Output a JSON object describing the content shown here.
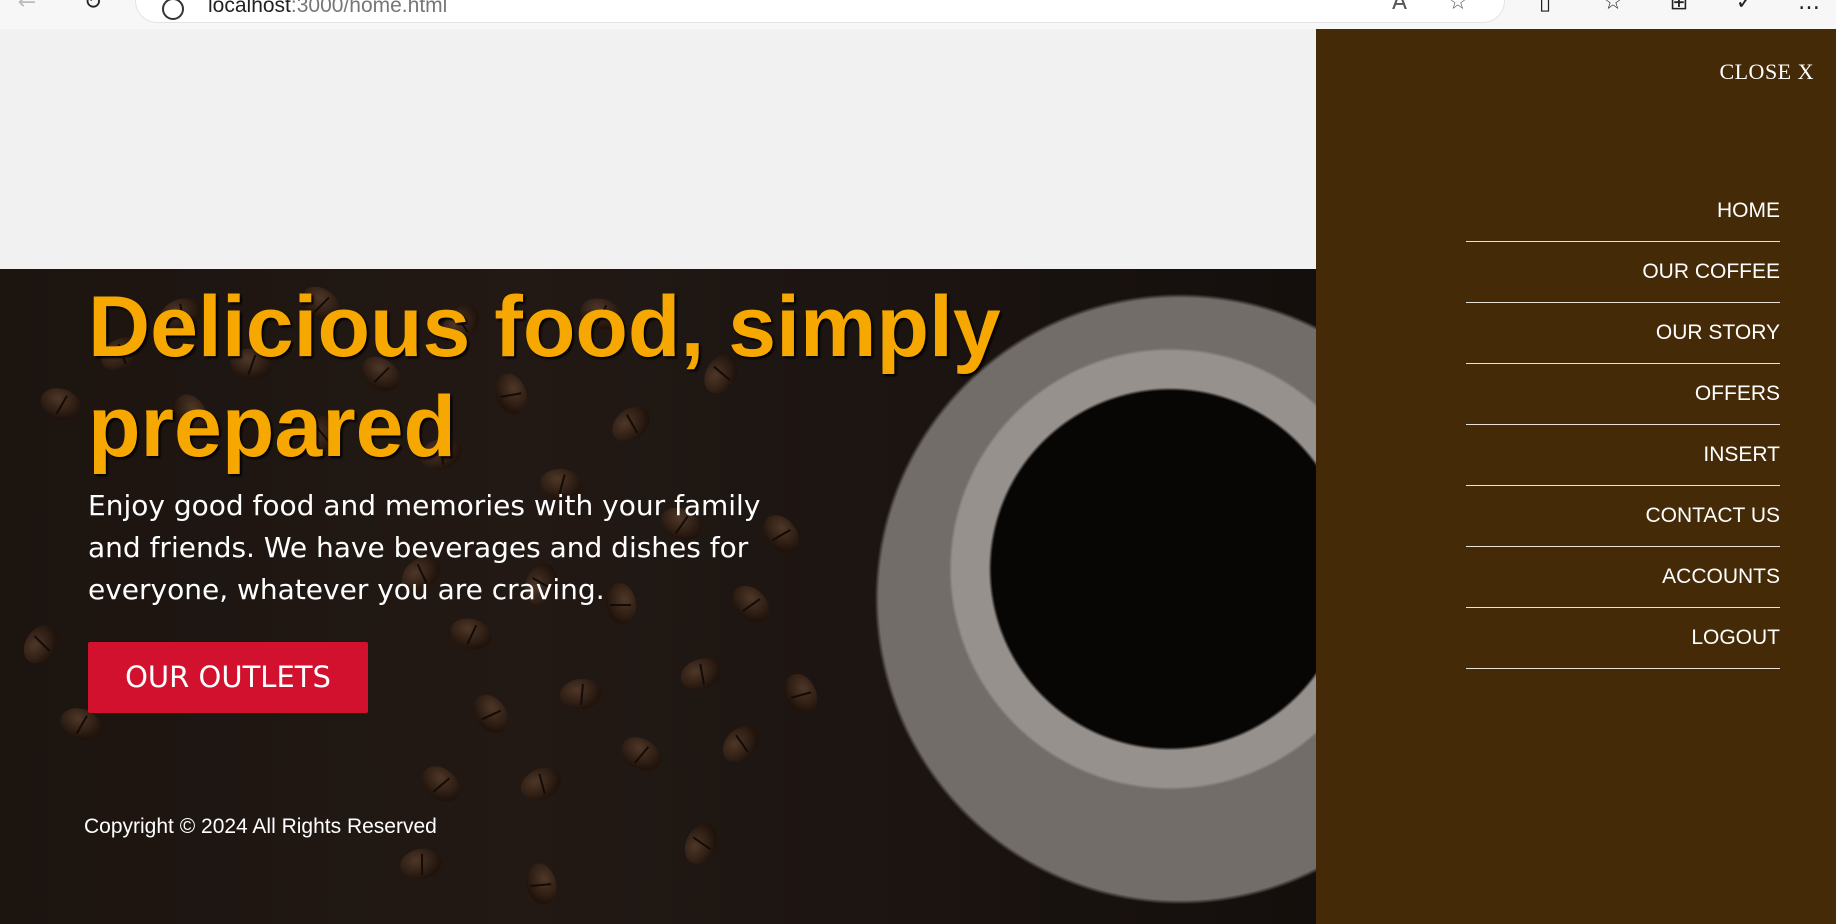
{
  "browser": {
    "url_host": "localhost",
    "url_rest": ":3000/home.html",
    "icons": [
      "back-icon",
      "refresh-icon",
      "info-icon",
      "read-aloud-icon",
      "favorite-star-icon",
      "split-screen-icon",
      "favorites-list-icon",
      "collections-icon",
      "extensions-icon",
      "more-icon"
    ]
  },
  "hero": {
    "title": "Delicious food, simply prepared",
    "text": "Enjoy good food and memories with your family and friends. We have beverages and dishes for everyone, whatever you are craving.",
    "button_label": "OUR OUTLETS",
    "copyright": "Copyright © 2024 All Rights Reserved"
  },
  "menu": {
    "close_label": "CLOSE X",
    "items": [
      {
        "label": "HOME"
      },
      {
        "label": "OUR COFFEE"
      },
      {
        "label": "OUR STORY"
      },
      {
        "label": "OFFERS"
      },
      {
        "label": "INSERT"
      },
      {
        "label": "CONTACT US"
      },
      {
        "label": "ACCOUNTS"
      },
      {
        "label": "LOGOUT"
      }
    ]
  },
  "colors": {
    "title": "#f6a800",
    "button": "#d2112f",
    "menu_background": "#452a07"
  }
}
